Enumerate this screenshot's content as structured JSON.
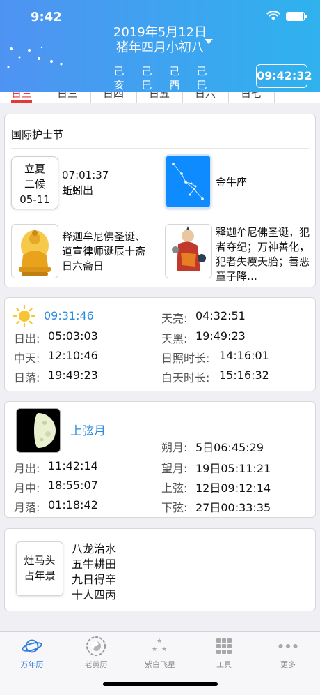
{
  "status_bar": {
    "time": "9:42"
  },
  "header": {
    "solar_date": "2019年5月12日",
    "lunar_date": "猪年四月小初八",
    "ganzhi": [
      {
        "top": "己",
        "bottom": "亥"
      },
      {
        "top": "己",
        "bottom": "巳"
      },
      {
        "top": "己",
        "bottom": "酉"
      },
      {
        "top": "己",
        "bottom": "巳"
      }
    ],
    "clock": "09:42:32"
  },
  "strip_tabs": [
    "日三",
    "日三",
    "日四",
    "日五",
    "日六",
    "日七"
  ],
  "festival_card": {
    "title": "国际护士节",
    "solar_term": {
      "line1": "立夏",
      "line2": "二候",
      "line3": "05-11"
    },
    "term_time": "07:01:37",
    "term_phenology": "蚯蚓出",
    "constellation": "金牛座",
    "buddha_event": "释迦牟尼佛圣诞、道宣律师诞辰十斋日六斋日",
    "immortal_event": "释迦牟尼佛圣诞，犯者夺纪；万神善化，犯者失瘼夭胎；善恶童子降…"
  },
  "sun_card": {
    "current": "09:31:46",
    "rows_left": [
      {
        "label": "日出:",
        "value": "05:03:03"
      },
      {
        "label": "中天:",
        "value": "12:10:46"
      },
      {
        "label": "日落:",
        "value": "19:49:23"
      }
    ],
    "rows_right": [
      {
        "label": "天亮:",
        "value": "04:32:51"
      },
      {
        "label": "天黑:",
        "value": "19:49:23"
      },
      {
        "label": "日照时长:",
        "value": "14:16:01"
      },
      {
        "label": "白天时长:",
        "value": "15:16:32"
      }
    ]
  },
  "moon_card": {
    "phase": "上弦月",
    "rows_left": [
      {
        "label": "月出:",
        "value": "11:42:14"
      },
      {
        "label": "月中:",
        "value": "18:55:07"
      },
      {
        "label": "月落:",
        "value": "01:18:42"
      }
    ],
    "rows_right": [
      {
        "label": "朔月:",
        "value": "5日06:45:29"
      },
      {
        "label": "望月:",
        "value": "19日05:11:21"
      },
      {
        "label": "上弦:",
        "value": "12日09:12:14"
      },
      {
        "label": "下弦:",
        "value": "27日00:33:35"
      }
    ]
  },
  "fortune_card": {
    "box_line1": "灶马头",
    "box_line2": "占年景",
    "lines": [
      "八龙治水",
      "五牛耕田",
      "九日得辛",
      "十人四丙"
    ]
  },
  "tabbar": {
    "tabs": [
      {
        "label": "万年历",
        "icon": "planet-icon"
      },
      {
        "label": "老黄历",
        "icon": "bagua-icon"
      },
      {
        "label": "紫白飞星",
        "icon": "stars-icon"
      },
      {
        "label": "工具",
        "icon": "grid-icon"
      },
      {
        "label": "更多",
        "icon": "more-dots-icon"
      }
    ]
  },
  "colors": {
    "header_start": "#4f93f2",
    "header_end": "#2fb2ee",
    "accent_blue": "#2a8be0",
    "active_tab": "#2a7de1"
  }
}
